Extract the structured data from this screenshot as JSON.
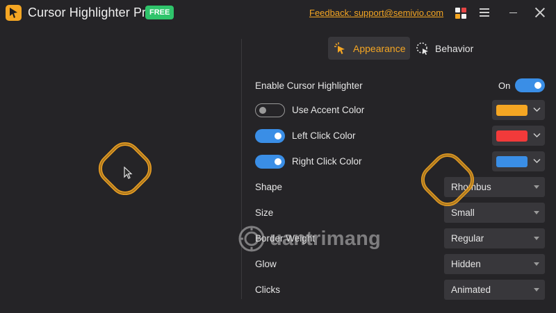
{
  "app": {
    "title": "Cursor Highlighter Pro",
    "badge": "FREE",
    "feedback": "Feedback: support@semivio.com",
    "accent_color": "#f5a623"
  },
  "tabs": [
    {
      "label": "Appearance",
      "icon": "cursor-click-icon",
      "active": true
    },
    {
      "label": "Behavior",
      "icon": "dotted-cursor-icon",
      "active": false
    }
  ],
  "settings": {
    "enable": {
      "label": "Enable Cursor Highlighter",
      "state": "On",
      "on": true
    },
    "accent": {
      "label": "Use Accent Color",
      "on": false,
      "color": "#f5a623"
    },
    "left_click": {
      "label": "Left Click Color",
      "on": true,
      "color": "#f23a3a"
    },
    "right_click": {
      "label": "Right Click Color",
      "on": true,
      "color": "#3a8ee6"
    },
    "shape": {
      "label": "Shape",
      "value": "Rhombus"
    },
    "size": {
      "label": "Size",
      "value": "Small"
    },
    "border": {
      "label": "Border Weight",
      "value": "Regular"
    },
    "glow": {
      "label": "Glow",
      "value": "Hidden"
    },
    "clicks": {
      "label": "Clicks",
      "value": "Animated"
    }
  },
  "watermark": "uantrimang"
}
